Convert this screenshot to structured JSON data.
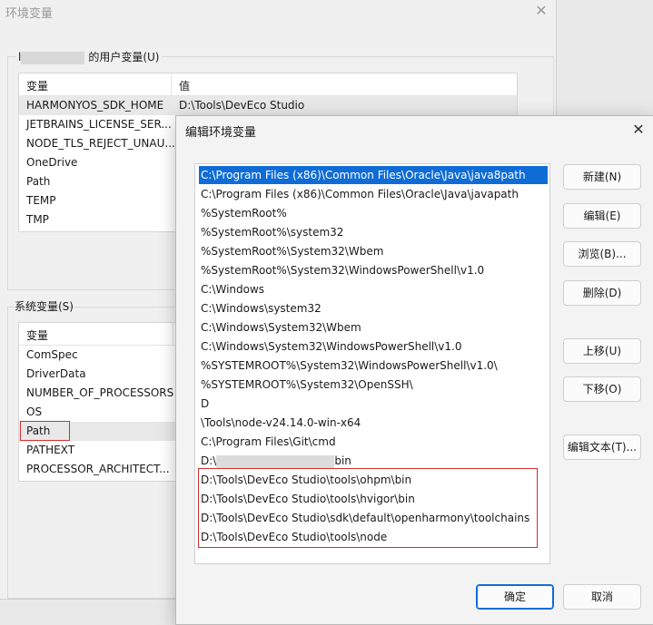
{
  "background_window": {
    "title": "环境变量",
    "close_glyph": "✕",
    "user_vars": {
      "label_suffix": "的用户变量(U)",
      "label_prefix": "l",
      "headers": {
        "name": "变量",
        "value": "值"
      },
      "rows": [
        {
          "name": "HARMONYOS_SDK_HOME",
          "value": "D:\\Tools\\DevEco Studio"
        },
        {
          "name": "JETBRAINS_LICENSE_SER..."
        },
        {
          "name": "NODE_TLS_REJECT_UNAU..."
        },
        {
          "name": "OneDrive"
        },
        {
          "name": "Path"
        },
        {
          "name": "TEMP"
        },
        {
          "name": "TMP"
        }
      ]
    },
    "system_vars": {
      "label": "系统变量(S)",
      "headers": {
        "name": "变量"
      },
      "rows": [
        {
          "name": "ComSpec"
        },
        {
          "name": "DriverData"
        },
        {
          "name": "NUMBER_OF_PROCESSORS"
        },
        {
          "name": "OS"
        },
        {
          "name": "Path"
        },
        {
          "name": "PATHEXT"
        },
        {
          "name": "PROCESSOR_ARCHITECT..."
        }
      ]
    }
  },
  "edit_dialog": {
    "title": "编辑环境变量",
    "close_glyph": "✕",
    "paths": [
      "C:\\Program Files (x86)\\Common Files\\Oracle\\Java\\java8path",
      "C:\\Program Files (x86)\\Common Files\\Oracle\\Java\\javapath",
      "%SystemRoot%",
      "%SystemRoot%\\system32",
      "%SystemRoot%\\System32\\Wbem",
      "%SystemRoot%\\System32\\WindowsPowerShell\\v1.0",
      "C:\\Windows",
      "C:\\Windows\\system32",
      "C:\\Windows\\System32\\Wbem",
      "C:\\Windows\\System32\\WindowsPowerShell\\v1.0",
      "%SYSTEMROOT%\\System32\\WindowsPowerShell\\v1.0\\",
      "%SYSTEMROOT%\\System32\\OpenSSH\\",
      "D",
      "\\Tools\\node-v24.14.0-win-x64",
      "C:\\Program Files\\Git\\cmd",
      "D:\\",
      "D:\\Tools\\DevEco Studio\\tools\\ohpm\\bin",
      "D:\\Tools\\DevEco Studio\\tools\\hvigor\\bin",
      "D:\\Tools\\DevEco Studio\\sdk\\default\\openharmony\\toolchains",
      "D:\\Tools\\DevEco Studio\\tools\\node"
    ],
    "redacted_suffix": "bin",
    "buttons": {
      "new": "新建(N)",
      "edit": "编辑(E)",
      "browse": "浏览(B)...",
      "delete": "删除(D)",
      "move_up": "上移(U)",
      "move_down": "下移(O)",
      "edit_text": "编辑文本(T)...",
      "ok": "确定",
      "cancel": "取消"
    }
  }
}
